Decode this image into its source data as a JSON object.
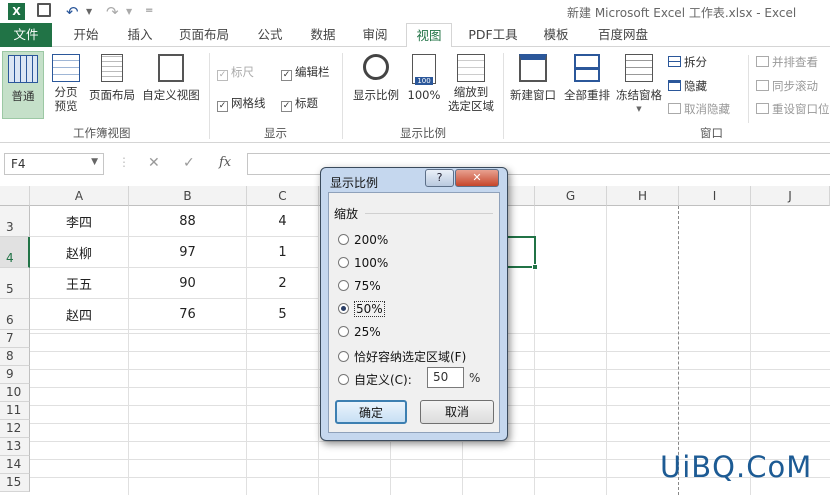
{
  "window": {
    "title": "新建 Microsoft Excel 工作表.xlsx - Excel"
  },
  "tabs": [
    "文件",
    "开始",
    "插入",
    "页面布局",
    "公式",
    "数据",
    "审阅",
    "视图",
    "PDF工具",
    "模板",
    "百度网盘"
  ],
  "active_tab": "视图",
  "ribbon": {
    "workbook_views": {
      "label": "工作簿视图",
      "normal": "普通",
      "page_break_1": "分页",
      "page_break_2": "预览",
      "page_layout": "页面布局",
      "custom_view": "自定义视图"
    },
    "show": {
      "label": "显示",
      "ruler": "标尺",
      "formula_bar": "编辑栏",
      "gridlines": "网格线",
      "headings": "标题"
    },
    "zoom": {
      "label": "显示比例",
      "zoom": "显示比例",
      "hundred": "100%",
      "to_sel_1": "缩放到",
      "to_sel_2": "选定区域"
    },
    "window": {
      "label": "窗口",
      "new_window": "新建窗口",
      "arrange_all": "全部重排",
      "freeze": "冻结窗格",
      "split": "拆分",
      "hide": "隐藏",
      "unhide": "取消隐藏",
      "side_by_side": "并排查看",
      "sync_scroll": "同步滚动",
      "reset_pos": "重设窗口位"
    }
  },
  "formula_bar": {
    "name_box": "F4",
    "fx": "fx",
    "cancel": "✕",
    "enter": "✓",
    "value": ""
  },
  "columns": [
    "A",
    "B",
    "C",
    "D",
    "E",
    "F",
    "G",
    "H",
    "I",
    "J"
  ],
  "rows": [
    {
      "num": "3",
      "a": "李四",
      "b": "88",
      "c": "4"
    },
    {
      "num": "4",
      "a": "赵柳",
      "b": "97",
      "c": "1"
    },
    {
      "num": "5",
      "a": "王五",
      "b": "90",
      "c": "2"
    },
    {
      "num": "6",
      "a": "赵四",
      "b": "76",
      "c": "5"
    },
    {
      "num": "7"
    },
    {
      "num": "8"
    },
    {
      "num": "9"
    },
    {
      "num": "10"
    },
    {
      "num": "11"
    },
    {
      "num": "12"
    },
    {
      "num": "13"
    },
    {
      "num": "14"
    },
    {
      "num": "15"
    }
  ],
  "dialog": {
    "title": "显示比例",
    "help": "?",
    "close": "✕",
    "group": "缩放",
    "options": [
      "200%",
      "100%",
      "75%",
      "50%",
      "25%",
      "恰好容纳选定区域(F)",
      "自定义(C):"
    ],
    "selected_index": 3,
    "custom_value": "50",
    "percent": "%",
    "ok": "确定",
    "cancel": "取消"
  },
  "watermark": "UiBQ.CoM",
  "colors": {
    "excel_green": "#217346",
    "dialog_frame": "#c5d7ee",
    "selection": "#217346"
  }
}
